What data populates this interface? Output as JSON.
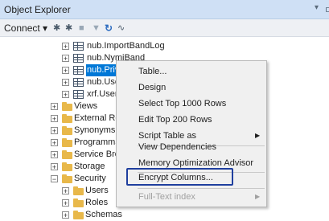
{
  "panel": {
    "title": "Object Explorer",
    "pin_glyph": "▾",
    "extra_glyph": "ㅁ"
  },
  "toolbar": {
    "connect_label": "Connect ▾",
    "icon1": "✱",
    "icon2": "✱",
    "icon3": "■",
    "icon4": "▼",
    "icon5": "↻",
    "icon6": "∿"
  },
  "tree": {
    "rows": [
      {
        "label": "nub.ImportBandLog",
        "type": "table"
      },
      {
        "label": "nub.NymiBand",
        "type": "table"
      },
      {
        "label": "nub.Priv",
        "type": "table",
        "selected": true
      },
      {
        "label": "nub.User",
        "type": "table"
      },
      {
        "label": "xrf.UserC",
        "type": "table"
      },
      {
        "label": "Views",
        "type": "folder"
      },
      {
        "label": "External Reso",
        "type": "folder"
      },
      {
        "label": "Synonyms",
        "type": "folder"
      },
      {
        "label": "Programmal",
        "type": "folder"
      },
      {
        "label": "Service Brok",
        "type": "folder"
      },
      {
        "label": "Storage",
        "type": "folder"
      },
      {
        "label": "Security",
        "type": "folder",
        "expanded": true
      },
      {
        "label": "Users",
        "type": "folder"
      },
      {
        "label": "Roles",
        "type": "folder"
      },
      {
        "label": "Schemas",
        "type": "folder"
      }
    ]
  },
  "context_menu": {
    "items": [
      {
        "label": "Table...",
        "submenu": false
      },
      {
        "label": "Design",
        "submenu": false
      },
      {
        "label": "Select Top 1000 Rows",
        "submenu": false
      },
      {
        "label": "Edit Top 200 Rows",
        "submenu": false
      },
      {
        "label": "Script Table as",
        "submenu": true
      },
      {
        "label": "View Dependencies",
        "submenu": false
      },
      {
        "label": "Memory Optimization Advisor",
        "submenu": false
      },
      {
        "label": "Encrypt Columns...",
        "submenu": false,
        "highlighted": true
      },
      {
        "label": "Full-Text index",
        "submenu": true,
        "disabled": true
      }
    ],
    "submenu_arrow": "▶"
  },
  "colors": {
    "title_bg": "#cfe0f5",
    "selection": "#0078d7",
    "highlight_border": "#1f3f9e",
    "folder": "#e8b84a"
  }
}
